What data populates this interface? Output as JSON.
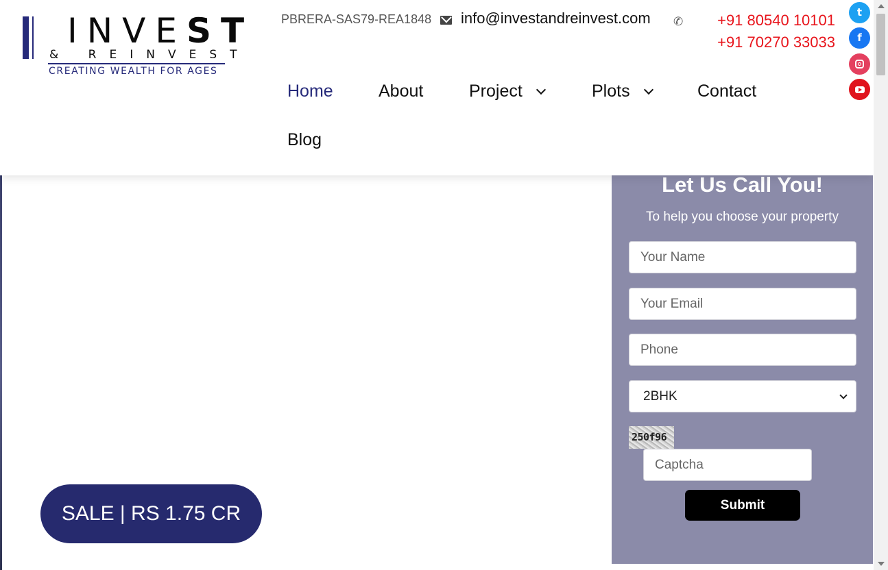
{
  "logo": {
    "word1_light": "INVE",
    "word1_bold": "ST",
    "word2": "& REINVEST",
    "tagline": "CREATING WEALTH FOR AGES"
  },
  "topbar": {
    "rera": "PBRERA-SAS79-REA1848",
    "email": "info@investandreinvest.com",
    "phone": "+91 80540 10101  +91 70270 33033"
  },
  "nav": {
    "items": [
      {
        "label": "Home",
        "active": true
      },
      {
        "label": "About"
      },
      {
        "label": "Project",
        "dropdown": true
      },
      {
        "label": "Plots",
        "dropdown": true
      },
      {
        "label": "Contact"
      },
      {
        "label": "Blog"
      }
    ]
  },
  "social": {
    "twitter_glyph": "t",
    "facebook_glyph": "f",
    "icons": [
      "twitter-icon",
      "facebook-icon",
      "instagram-icon",
      "youtube-icon"
    ]
  },
  "form": {
    "title": "Let Us Call You!",
    "subtitle": "To help you choose your property",
    "name_placeholder": "Your Name",
    "email_placeholder": "Your Email",
    "phone_placeholder": "Phone",
    "select_value": "2BHK",
    "captcha_code": "250f96",
    "captcha_placeholder": "Captcha",
    "submit_label": "Submit"
  },
  "sale": {
    "label": "SALE | RS 1.75 CR"
  },
  "colors": {
    "brand_navy": "#262a6e",
    "phone_red": "#e8141b",
    "form_bg": "#8b8ba9"
  }
}
